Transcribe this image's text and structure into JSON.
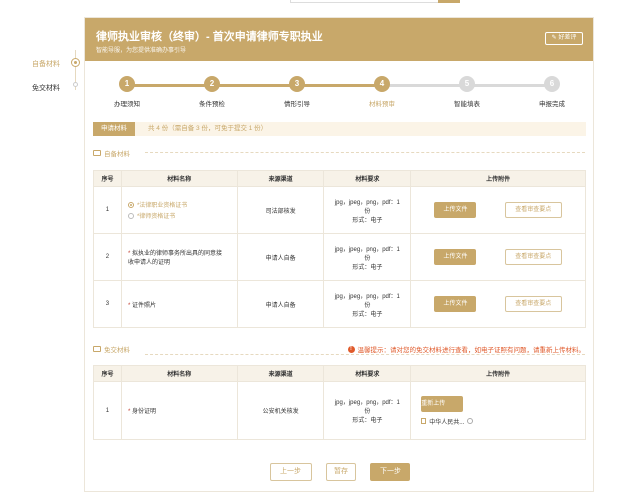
{
  "left_nav": {
    "items": [
      {
        "label": "自备材料",
        "active": true
      },
      {
        "label": "免交材料",
        "active": false
      }
    ]
  },
  "header": {
    "title": "律师执业审核（终审）- 首次申请律师专职执业",
    "subtitle": "智能导服，为您提供准确办事引导",
    "rate_label": "好差评",
    "rate_icon": "edit-icon"
  },
  "steps": [
    {
      "num": "1",
      "label": "办理须知",
      "state": "done"
    },
    {
      "num": "2",
      "label": "条件预检",
      "state": "done"
    },
    {
      "num": "3",
      "label": "情形引导",
      "state": "done"
    },
    {
      "num": "4",
      "label": "材料预审",
      "state": "current"
    },
    {
      "num": "5",
      "label": "智能填表",
      "state": "todo"
    },
    {
      "num": "6",
      "label": "申报完成",
      "state": "todo"
    }
  ],
  "summary": {
    "tag": "申请材料",
    "text": "共 4 份（需自备 3 份，可免于提交 1 份）"
  },
  "self_section": {
    "title": "自备材料",
    "headers": [
      "序号",
      "材料名称",
      "来源渠道",
      "材料要求",
      "上传附件"
    ],
    "rows": [
      {
        "no": "1",
        "options": [
          "*法律职业资格证书",
          "*律师资格证书"
        ],
        "source": "司法部核发",
        "req1": "jpg，jpeg，png，pdf：1",
        "req2": "份",
        "req3": "形式：电子",
        "upload": "上传文件",
        "view": "查看审查要点"
      },
      {
        "no": "2",
        "name_line1": "拟执业的律师事务所出具的同意接",
        "name_line2": "收申请人的证明",
        "source": "申请人自备",
        "req1": "jpg，jpeg，png，pdf：1",
        "req2": "份",
        "req3": "形式：电子",
        "upload": "上传文件",
        "view": "查看审查要点"
      },
      {
        "no": "3",
        "name_line1": "证件照片",
        "source": "申请人自备",
        "req1": "jpg，jpeg，png，pdf：1",
        "req2": "份",
        "req3": "形式：电子",
        "upload": "上传文件",
        "view": "查看审查要点"
      }
    ]
  },
  "exempt_section": {
    "title": "免交材料",
    "tip": "温馨提示：请对您的免交材料进行查看，如电子证照有问题，请重新上传材料。",
    "headers": [
      "序号",
      "材料名称",
      "来源渠道",
      "材料要求",
      "上传附件"
    ],
    "rows": [
      {
        "no": "1",
        "name_line1": "身份证明",
        "source": "公安机关核发",
        "req1": "jpg，jpeg，png，pdf：1",
        "req2": "份",
        "req3": "形式：电子",
        "reupload": "重新上传",
        "file_name": "中华人民共..."
      }
    ]
  },
  "footer": {
    "prev": "上一步",
    "save": "暂存",
    "next": "下一步"
  },
  "colors": {
    "brand": "#c8a86a",
    "step_done": "#c8a86a",
    "step_todo": "#d9d9d9",
    "warning": "#e05a2b",
    "required": "#c0392b"
  }
}
